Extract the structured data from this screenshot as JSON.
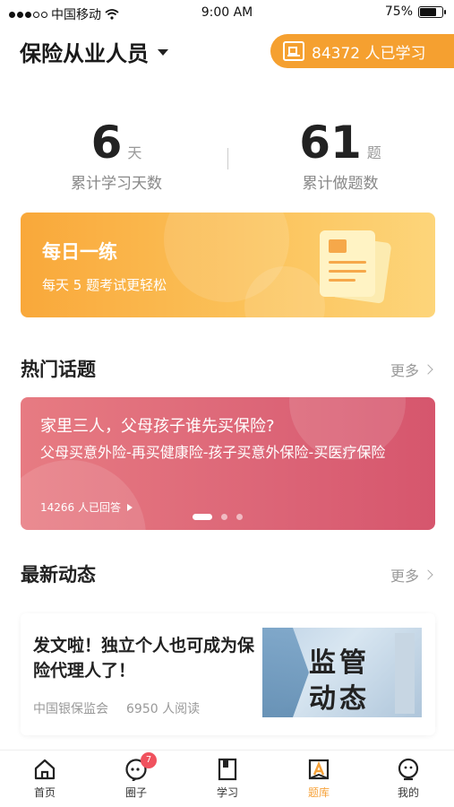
{
  "status_bar": {
    "carrier": "中国移动",
    "time": "9:00 AM",
    "battery": "75%",
    "battery_level": 0.75
  },
  "header": {
    "role_title": "保险从业人员",
    "learners_text": "84372 人已学习"
  },
  "stats": {
    "days": {
      "value": "6",
      "unit": "天",
      "label": "累计学习天数"
    },
    "questions": {
      "value": "61",
      "unit": "题",
      "label": "累计做题数"
    }
  },
  "daily_practice": {
    "title": "每日一练",
    "subtitle": "每天 5 题考试更轻松"
  },
  "hot_topics": {
    "title": "热门话题",
    "more": "更多",
    "card": {
      "title": "家里三人，父母孩子谁先买保险?",
      "description": "父母买意外险-再买健康险-孩子买意外保险-买医疗保险",
      "answers": "14266 人已回答"
    },
    "carousel_pages": 3,
    "carousel_active": 1
  },
  "latest": {
    "title": "最新动态",
    "more": "更多",
    "article": {
      "title": "发文啦！独立个人也可成为保险代理人了！",
      "source": "中国银保监会",
      "reads": "6950 人阅读",
      "thumb_line1": "监管",
      "thumb_line2": "动态"
    }
  },
  "tab_bar": {
    "tabs": [
      {
        "label": "首页",
        "icon": "home-icon"
      },
      {
        "label": "圈子",
        "icon": "circle-icon",
        "badge": "7"
      },
      {
        "label": "学习",
        "icon": "book-icon"
      },
      {
        "label": "题库",
        "icon": "question-bank-icon",
        "active": true
      },
      {
        "label": "我的",
        "icon": "profile-icon"
      }
    ]
  },
  "colors": {
    "accent": "#f6a23a",
    "topic_card": "#dc6577",
    "badge": "#f0525e"
  }
}
